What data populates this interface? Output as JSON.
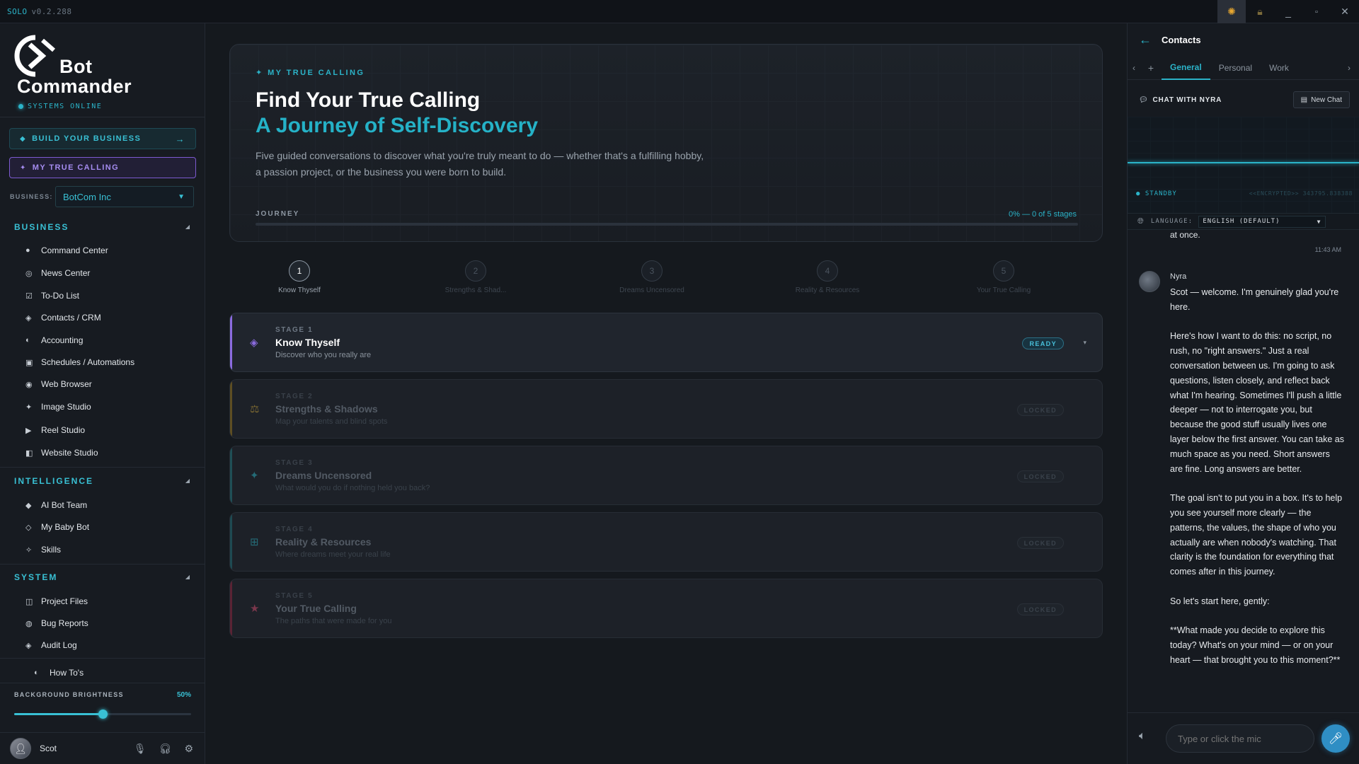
{
  "titlebar": {
    "app": "SOLO",
    "version": "v0.2.288"
  },
  "sidebar": {
    "logo_line1": "Bot",
    "logo_line2": "Commander",
    "status": "SYSTEMS ONLINE",
    "build_button": "BUILD YOUR BUSINESS",
    "calling_button": "MY TRUE CALLING",
    "business_label": "BUSINESS:",
    "business_value": "BotCom Inc",
    "sections": {
      "business": "BUSINESS",
      "intelligence": "INTELLIGENCE",
      "system": "SYSTEM"
    },
    "business_items": [
      "Command Center",
      "News Center",
      "To-Do List",
      "Contacts / CRM",
      "Accounting",
      "Schedules / Automations",
      "Web Browser",
      "Image Studio",
      "Reel Studio",
      "Website Studio"
    ],
    "intelligence_items": [
      "AI Bot Team",
      "My Baby Bot",
      "Skills"
    ],
    "system_items": [
      "Project Files",
      "Bug Reports",
      "Audit Log"
    ],
    "howtos": "How To's",
    "brightness_label": "BACKGROUND BRIGHTNESS",
    "brightness_value": "50%",
    "brightness": 0.5,
    "user_name": "Scot"
  },
  "hero": {
    "eyebrow": "MY TRUE CALLING",
    "title": "Find Your True Calling",
    "subtitle": "A Journey of Self-Discovery",
    "description": "Five guided conversations to discover what you're truly meant to do — whether that's a fulfilling hobby, a passion project, or the business you were born to build.",
    "journey_label": "JOURNEY",
    "journey_value": "0% — 0 of 5 stages"
  },
  "steps": [
    {
      "n": "1",
      "label": "Know Thyself"
    },
    {
      "n": "2",
      "label": "Strengths & Shad..."
    },
    {
      "n": "3",
      "label": "Dreams Uncensored"
    },
    {
      "n": "4",
      "label": "Reality & Resources"
    },
    {
      "n": "5",
      "label": "Your True Calling"
    }
  ],
  "stages": [
    {
      "num": "STAGE 1",
      "title": "Know Thyself",
      "sub": "Discover who you really are",
      "badge": "READY"
    },
    {
      "num": "STAGE 2",
      "title": "Strengths & Shadows",
      "sub": "Map your talents and blind spots",
      "badge": "LOCKED"
    },
    {
      "num": "STAGE 3",
      "title": "Dreams Uncensored",
      "sub": "What would you do if nothing held you back?",
      "badge": "LOCKED"
    },
    {
      "num": "STAGE 4",
      "title": "Reality & Resources",
      "sub": "Where dreams meet your real life",
      "badge": "LOCKED"
    },
    {
      "num": "STAGE 5",
      "title": "Your True Calling",
      "sub": "The paths that were made for you",
      "badge": "LOCKED"
    }
  ],
  "colors": {
    "accent": "#2bb3c8",
    "purple": "#8b6be0",
    "gold": "#c9a23a",
    "teal": "#2aa9b8",
    "pink": "#c94a6a"
  },
  "chat": {
    "title": "Contacts",
    "tabs": [
      "General",
      "Personal",
      "Work"
    ],
    "with": "CHAT WITH NYRA",
    "new_chat": "New Chat",
    "standby": "STANDBY",
    "encrypted": "<<ENCRYPTED>> 343795.838388",
    "language_label": "LANGUAGE:",
    "language_value": "ENGLISH (DEFAULT)",
    "prev_tail": "at once.",
    "time": "11:43 AM",
    "sender": "Nyra",
    "paragraphs": [
      "Scot — welcome. I'm genuinely glad you're here.",
      "Here's how I want to do this: no script, no rush, no \"right answers.\" Just a real conversation between us. I'm going to ask questions, listen closely, and reflect back what I'm hearing. Sometimes I'll push a little deeper — not to interrogate you, but because the good stuff usually lives one layer below the first answer. You can take as much space as you need. Short answers are fine. Long answers are better.",
      "The goal isn't to put you in a box. It's to help you see yourself more clearly — the patterns, the values, the shape of who you actually are when nobody's watching. That clarity is the foundation for everything that comes after in this journey.",
      "So let's start here, gently:",
      "**What made you decide to explore this today? What's on your mind — or on your heart — that brought you to this moment?**"
    ],
    "input_placeholder": "Type or click the mic"
  }
}
